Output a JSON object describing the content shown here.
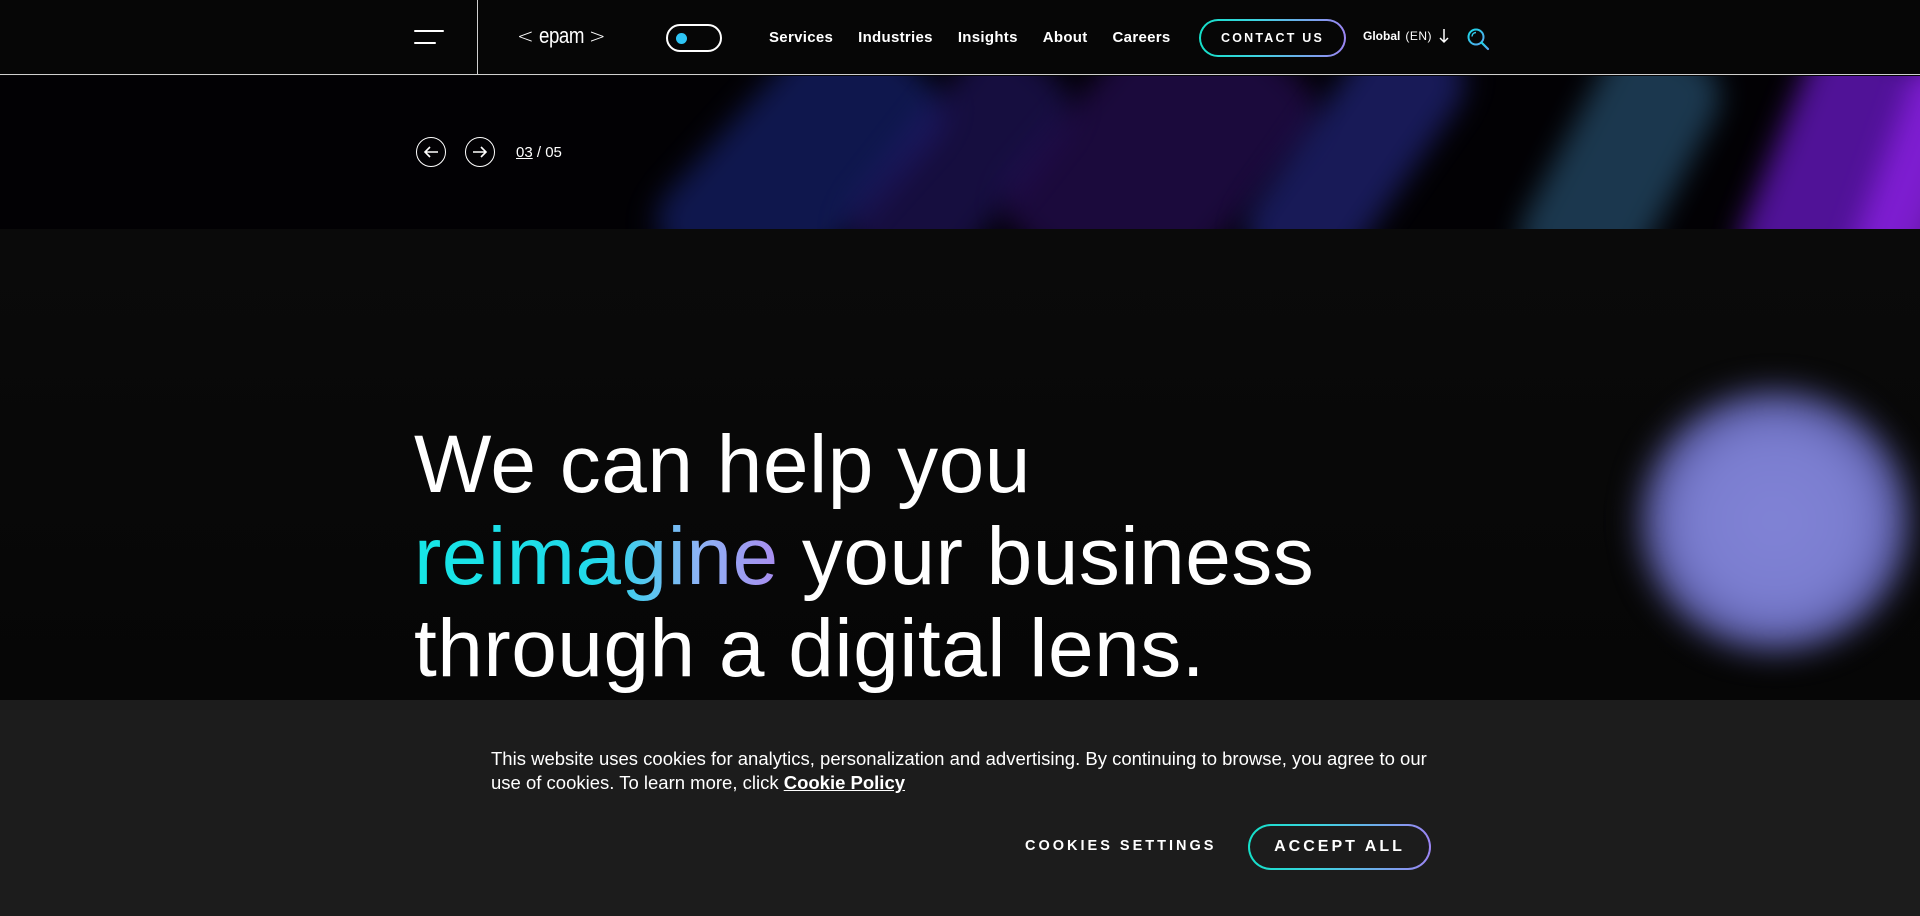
{
  "header": {
    "logo": {
      "open": "<",
      "text": "epam",
      "close": ">"
    },
    "nav": [
      "Services",
      "Industries",
      "Insights",
      "About",
      "Careers"
    ],
    "contact_label": "CONTACT US",
    "lang": {
      "region": "Global",
      "code": "(EN)"
    },
    "icons": {
      "menu": "hamburger-icon",
      "toggle": "theme-toggle",
      "lang_arrow": "arrow-down-icon",
      "search": "search-icon"
    }
  },
  "carousel": {
    "current": "03",
    "separator": "/",
    "total": "05"
  },
  "hero": {
    "line1": "We can help you",
    "highlight": "reimagine",
    "line2_rest": " your business",
    "line3": "through a digital lens."
  },
  "cookie": {
    "text": "This website uses cookies for analytics, personalization and advertising. By continuing to browse, you agree to our use of cookies. To learn more, click ",
    "link_label": "Cookie Policy",
    "settings_label": "COOKIES SETTINGS",
    "accept_label": "ACCEPT ALL"
  },
  "colors": {
    "background": "#060606",
    "accent_cyan": "#14e0c9",
    "accent_violet": "#9c85f4",
    "toggle_knob": "#2ec5f5",
    "banner": "#1c1c1c"
  }
}
